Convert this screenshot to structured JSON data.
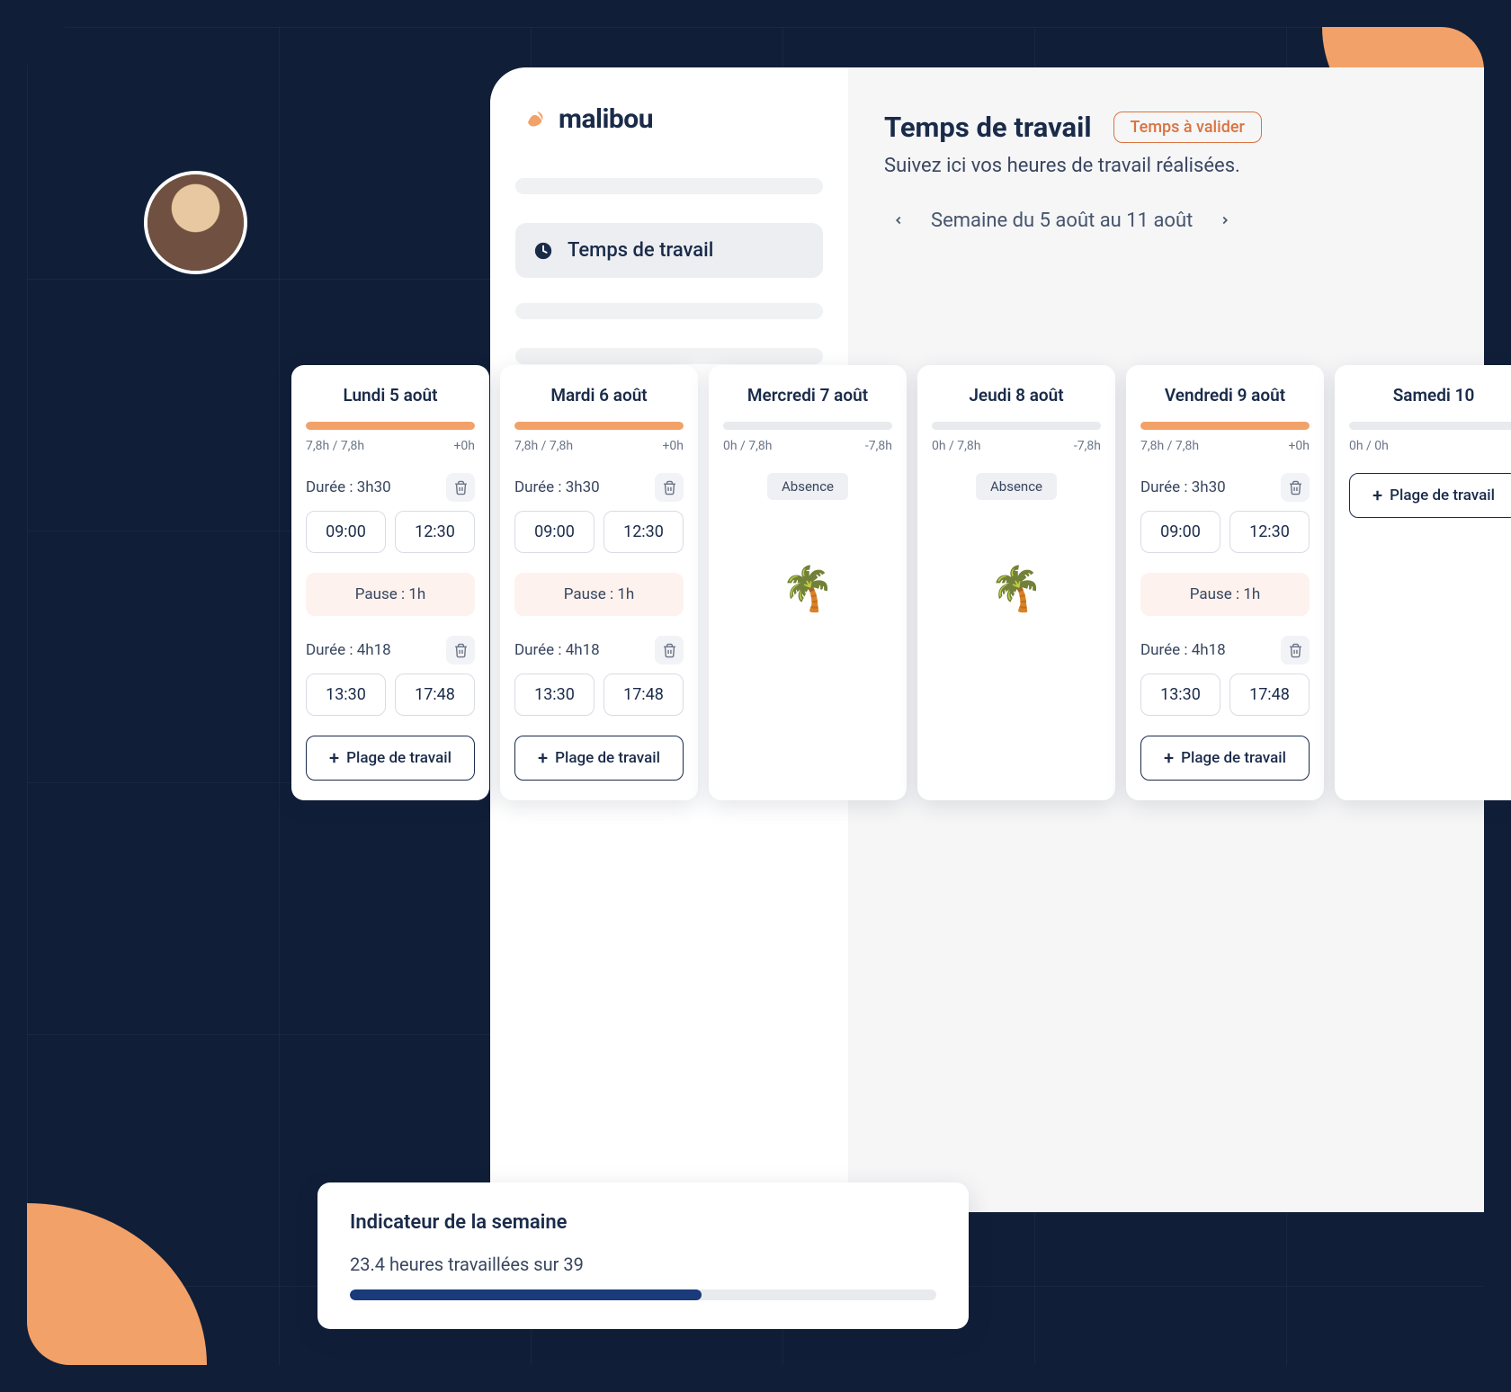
{
  "brand": {
    "name": "malibou"
  },
  "nav": {
    "active_label": "Temps de travail"
  },
  "header": {
    "title": "Temps de travail",
    "validate_label": "Temps à valider",
    "subtitle": "Suivez ici vos heures de travail réalisées.",
    "week_label": "Semaine du 5 août au 11 août"
  },
  "colors": {
    "progress_full": "#f2a168",
    "progress_track": "#e8eaed",
    "indicator_fill": "#1a3a7a"
  },
  "days": [
    {
      "title": "Lundi 5 août",
      "worked": "7,8h / 7,8h",
      "delta": "+0h",
      "fill_pct": 100,
      "type": "work",
      "slots": [
        {
          "duration": "Durée : 3h30",
          "start": "09:00",
          "end": "12:30"
        },
        {
          "duration": "Durée : 4h18",
          "start": "13:30",
          "end": "17:48"
        }
      ],
      "pause": "Pause : 1h",
      "add_label": "Plage de travail"
    },
    {
      "title": "Mardi 6 août",
      "worked": "7,8h / 7,8h",
      "delta": "+0h",
      "fill_pct": 100,
      "type": "work",
      "slots": [
        {
          "duration": "Durée : 3h30",
          "start": "09:00",
          "end": "12:30"
        },
        {
          "duration": "Durée : 4h18",
          "start": "13:30",
          "end": "17:48"
        }
      ],
      "pause": "Pause : 1h",
      "add_label": "Plage de travail"
    },
    {
      "title": "Mercredi 7 août",
      "worked": "0h / 7,8h",
      "delta": "-7,8h",
      "fill_pct": 0,
      "type": "absence",
      "absence_label": "Absence"
    },
    {
      "title": "Jeudi 8 août",
      "worked": "0h / 7,8h",
      "delta": "-7,8h",
      "fill_pct": 0,
      "type": "absence",
      "absence_label": "Absence"
    },
    {
      "title": "Vendredi 9 août",
      "worked": "7,8h / 7,8h",
      "delta": "+0h",
      "fill_pct": 100,
      "type": "work",
      "slots": [
        {
          "duration": "Durée : 3h30",
          "start": "09:00",
          "end": "12:30"
        },
        {
          "duration": "Durée : 4h18",
          "start": "13:30",
          "end": "17:48"
        }
      ],
      "pause": "Pause : 1h",
      "add_label": "Plage de travail"
    },
    {
      "title": "Samedi 10",
      "worked": "0h / 0h",
      "delta": "",
      "fill_pct": 0,
      "type": "empty",
      "add_label": "Plage de travail"
    }
  ],
  "indicator": {
    "title": "Indicateur de la semaine",
    "subtitle": "23.4 heures travaillées sur 39",
    "fill_pct": 60
  }
}
